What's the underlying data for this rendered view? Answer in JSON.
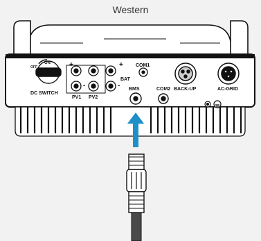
{
  "title": "Western",
  "labels": {
    "dc_switch": "DC  SWITCH",
    "switch_on": "ON",
    "switch_off": "OFF",
    "pv1": "PV1",
    "pv2": "PV2",
    "bat": "BAT",
    "com1": "COM1",
    "bms": "BMS",
    "com2": "COM2",
    "back_up": "BACK-UP",
    "ac_grid": "AC-GRID",
    "plus": "+",
    "minus": "-"
  },
  "colors": {
    "background": "#f2f2f2",
    "line": "#111111",
    "arrow": "#1f8fc9",
    "cable": "#4a4a4a"
  },
  "icons": [
    "ground-icon",
    "arrow-up-icon"
  ]
}
